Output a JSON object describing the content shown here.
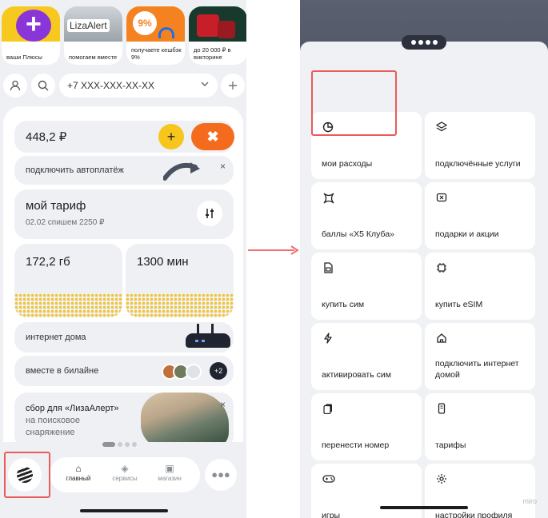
{
  "stories": [
    {
      "caption": "ваши Плюсы",
      "icon": "plus-story-icon"
    },
    {
      "caption": "помогаем вместе",
      "logo_text": "LizaAlert",
      "icon": "lizaalert-story-icon"
    },
    {
      "caption": "получаете кешбэк 9%",
      "badge": "9%",
      "icon": "cashback-story-icon"
    },
    {
      "caption": "до 20 000 ₽ в викторине",
      "icon": "gift-story-icon"
    }
  ],
  "phone_bar": {
    "number": "+7 XXX-XXX-XX-XX",
    "profile_icon": "person-icon",
    "search_icon": "search-icon",
    "add_icon": "plus-icon"
  },
  "balance": {
    "amount": "448,2 ₽",
    "pay_symbol": "+",
    "close_symbol": "✖"
  },
  "autopay": {
    "label": "подключить автоплатёж",
    "close_symbol": "×"
  },
  "tariff": {
    "title": "мой тариф",
    "subtitle": "02.02 спишем 2250 ₽"
  },
  "usage": {
    "internet": "172,2 гб",
    "minutes": "1300 мин"
  },
  "home_internet": {
    "label": "интернет дома"
  },
  "together": {
    "label": "вместе в билайне",
    "count": "+2"
  },
  "fundraiser": {
    "line1": "сбор для «ЛизаАлерт»",
    "line2": "на поисковое",
    "line3": "снаряжение",
    "close_symbol": "×"
  },
  "tabs": [
    {
      "label": "главный",
      "active": true,
      "icon": "home-icon"
    },
    {
      "label": "сервисы",
      "active": false,
      "icon": "layers-icon"
    },
    {
      "label": "магазин",
      "active": false,
      "icon": "shop-bag-icon"
    }
  ],
  "menu": [
    {
      "label": "мои расходы",
      "icon": "pie-chart-icon"
    },
    {
      "label": "подключённые услуги",
      "icon": "layers-icon"
    },
    {
      "label": "баллы «Х5 Клуба»",
      "icon": "x5-club-icon"
    },
    {
      "label": "подарки и акции",
      "icon": "gift-card-icon"
    },
    {
      "label": "купить сим",
      "icon": "sim-card-icon"
    },
    {
      "label": "купить eSIM",
      "icon": "esim-chip-icon"
    },
    {
      "label": "активировать сим",
      "icon": "lightning-icon"
    },
    {
      "label": "подключить интернет домой",
      "icon": "house-icon"
    },
    {
      "label": "перенести номер",
      "icon": "transfer-sim-icon"
    },
    {
      "label": "тарифы",
      "icon": "tariff-phone-icon"
    },
    {
      "label": "игры",
      "icon": "gamepad-icon"
    },
    {
      "label": "настройки профиля",
      "icon": "gear-icon"
    }
  ],
  "watermark": "miro",
  "colors": {
    "brand_yellow": "#f6c61d",
    "accent_orange": "#f46b1d",
    "highlight_red": "#ea5b5b",
    "arrow_red": "#f07070"
  }
}
